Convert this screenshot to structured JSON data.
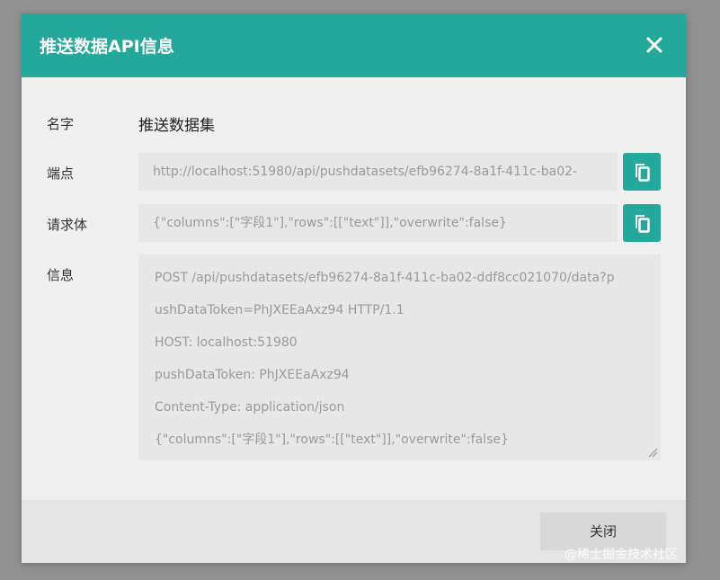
{
  "dialog": {
    "title": "推送数据API信息",
    "close_icon": "close-icon"
  },
  "fields": {
    "name": {
      "label": "名字",
      "value": "推送数据集"
    },
    "endpoint": {
      "label": "端点",
      "value": "http://localhost:51980/api/pushdatasets/efb96274-8a1f-411c-ba02-",
      "copy_icon": "copy-icon"
    },
    "request_body": {
      "label": "请求体",
      "value": "{\"columns\":[\"字段1\"],\"rows\":[[\"text\"]],\"overwrite\":false}",
      "copy_icon": "copy-icon"
    },
    "info": {
      "label": "信息",
      "lines": [
        "POST /api/pushdatasets/efb96274-8a1f-411c-ba02-ddf8cc021070/data?p",
        "ushDataToken=PhJXEEaAxz94 HTTP/1.1",
        "HOST: localhost:51980",
        "pushDataToken: PhJXEEaAxz94",
        "Content-Type: application/json",
        "{\"columns\":[\"字段1\"],\"rows\":[[\"text\"]],\"overwrite\":false}"
      ]
    }
  },
  "footer": {
    "close_label": "关闭"
  },
  "watermark": "@稀土掘金技术社区",
  "colors": {
    "accent": "#24a89b",
    "background": "#929292",
    "dialog": "#f0f0f0",
    "input": "#e7e7e7"
  }
}
